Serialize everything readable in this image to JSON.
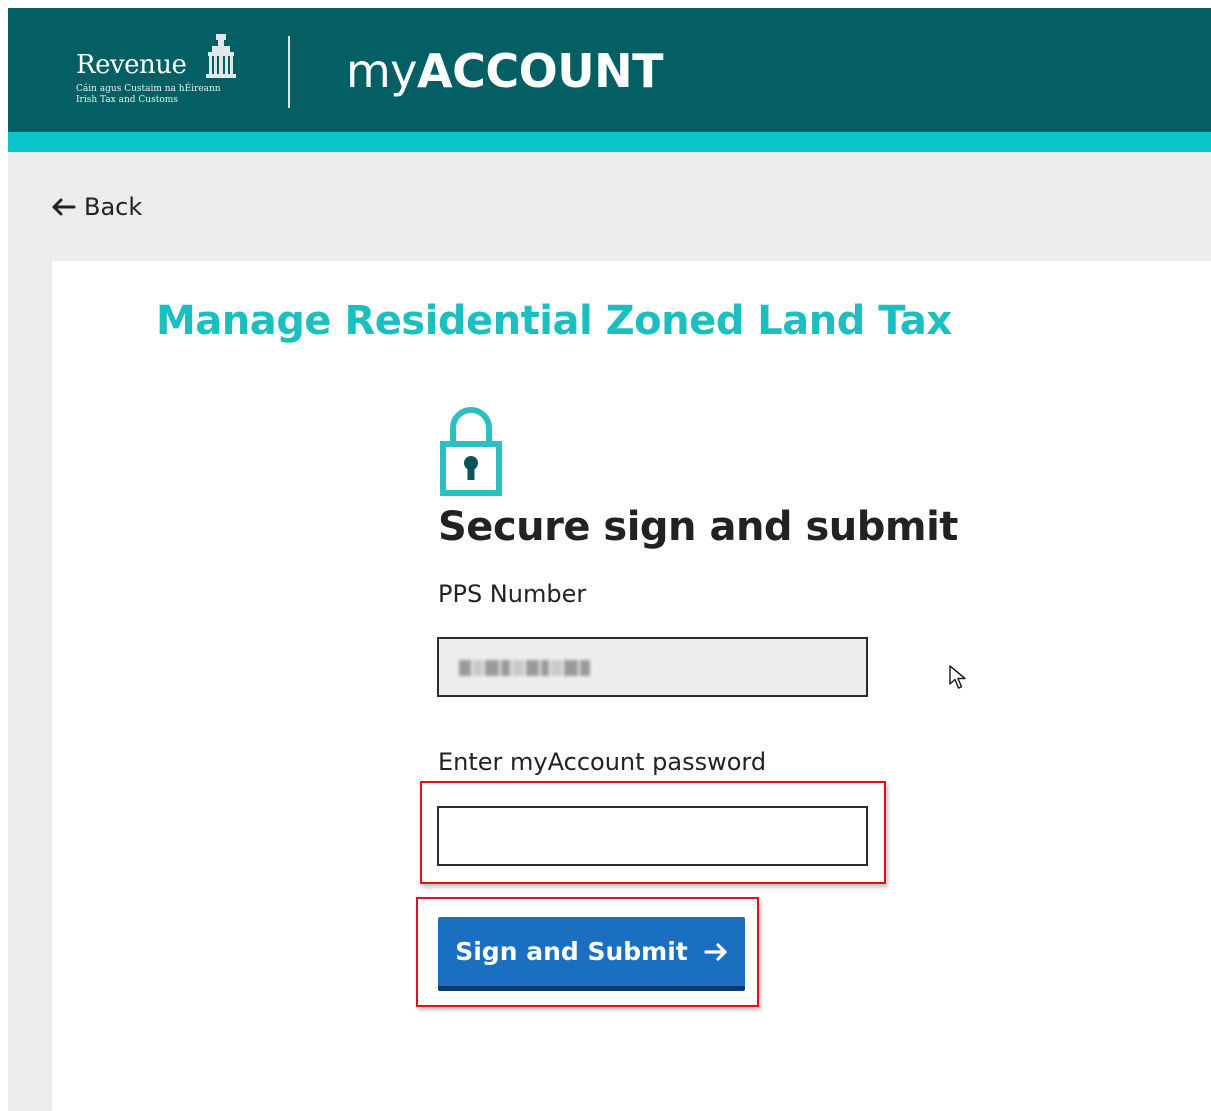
{
  "header": {
    "logo_word": "Revenue",
    "logo_tagline_1": "Cáin agus Custaim na hÉireann",
    "logo_tagline_2": "Irish Tax and Customs",
    "app_title_my": "my",
    "app_title_account": "ACCOUNT"
  },
  "nav": {
    "back_label": "Back"
  },
  "main": {
    "page_title": "Manage Residential Zoned Land Tax",
    "section_title": "Secure sign and submit",
    "pps_label": "PPS Number",
    "password_label": "Enter myAccount password",
    "password_value": "",
    "submit_label": "Sign and Submit"
  },
  "colors": {
    "header_bg": "#035f63",
    "header_accent": "#0ac6c9",
    "title_teal": "#1bbfbf",
    "button_blue": "#1a6fc0",
    "highlight_red": "#e0101f"
  },
  "icons": {
    "lock": "lock-icon",
    "back": "arrow-left-icon",
    "submit": "arrow-right-icon",
    "cursor": "mouse-pointer-icon"
  }
}
